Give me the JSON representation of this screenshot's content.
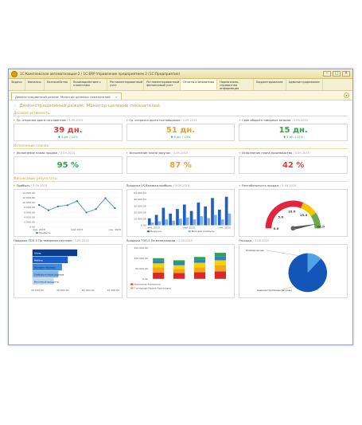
{
  "window": {
    "title": "1С:Комплексная автоматизация 2 / 1С:ERP Управление предприятием 2 (1С:Предприятие)"
  },
  "sections": [
    {
      "label": "Задачи"
    },
    {
      "label": "Финансы"
    },
    {
      "label": "Казначейство"
    },
    {
      "label": "Взаимодействие с клиентами"
    },
    {
      "label": "Регламентированный учет"
    },
    {
      "label": "Регламентированный финансовый учет"
    },
    {
      "label": "Отчеты и аналитика"
    },
    {
      "label": "Нормативно-справочная информация"
    },
    {
      "label": "Бюджетирование"
    },
    {
      "label": "Администрирование"
    }
  ],
  "tab": {
    "label": "Демонстрационный режим: Монитор целевых показателей",
    "close": "×"
  },
  "page": {
    "title": "Демонстрационный режим: Монитор целевых показателей"
  },
  "sec1": {
    "title": "Деловая активность",
    "kpis": [
      {
        "label": "Ср. отсрочка долга по клиентам",
        "date": "/ 3.09.2015",
        "value": "39 дн.",
        "sub": "▼ 4 дн. / 10%",
        "color": "#e03a3a"
      },
      {
        "label": "Ср. отсрочка долга поставщикам",
        "date": "/ 3.09.2015",
        "value": "51 дн.",
        "sub": "▼ 6 дн. / 13%",
        "color": "#f0a020"
      },
      {
        "label": "Срок оборота товарных запасов",
        "date": "/ 3.09.2015",
        "value": "15 дн.",
        "sub": "▼ 3 дн. / 21%",
        "color": "#2fa34a"
      }
    ]
  },
  "sec2": {
    "title": "Исполнение планов",
    "kpis": [
      {
        "label": "Исполнение плана продаж",
        "date": "/ 3.09.2015",
        "value": "95 %",
        "color": "#2fa34a"
      },
      {
        "label": "Исполнение плана закупок",
        "date": "/ 3.09.2015",
        "value": "87 %",
        "color": "#f0a020"
      },
      {
        "label": "Исполнение плана производства",
        "date": "/ 3.09.2015",
        "value": "42 %",
        "color": "#e03a3a"
      }
    ]
  },
  "sec3": {
    "title": "Финансовые результаты"
  },
  "charts": {
    "profit": {
      "label": "Прибыль",
      "date": "/ 3.09.2015",
      "legend": "Прибыль"
    },
    "sales": {
      "label": "Продажи VS Валовая прибыль",
      "date": "/ 3.09.2015",
      "legend1": "Выручка",
      "legend2": "Валовая прибыль"
    },
    "profitability": {
      "label": "Рентабельность продаж",
      "date": "/ 3.09.2015"
    },
    "salesGroups": {
      "label": "Продажи ТОП-5 По товарным группам",
      "date": "/ 3.09.2015"
    },
    "salesManagers": {
      "label": "Продажи ТОП-5 По менеджерам",
      "date": "/ 3.09.2015",
      "legend1": "Максимов Филиппов",
      "legend2": "Гончарова Ирина Архиповна"
    },
    "expenses": {
      "label": "Расходы",
      "date": "/ 3.09.2015",
      "slice1": "Коммерческие",
      "slice2": "Административные расходы"
    }
  },
  "chart_data": [
    {
      "type": "line",
      "title": "Прибыль",
      "x": [
        "янв. 2015",
        "фев. 2015",
        "мар. 2015",
        "апр. 2015",
        "май 2015",
        "июн. 2015",
        "июл. 2015",
        "авг. 2015",
        "сен. 2015"
      ],
      "xticks": [
        "янв. 2015",
        "май 2015",
        "сен. 2015"
      ],
      "series": [
        {
          "name": "Прибыль",
          "values": [
            9000,
            6800,
            8400,
            8900,
            10600,
            5900,
            7300,
            11800,
            7700
          ]
        }
      ],
      "yticks": [
        "14 000.00",
        "12 000.00",
        "10 000.00",
        "8 000.00",
        "6 000.00",
        "4 000.00",
        "2 000.00",
        "0.00"
      ],
      "ylim": [
        0,
        14000
      ]
    },
    {
      "type": "bar",
      "title": "Продажи VS Валовая прибыль",
      "xticks": [
        "янв. 2015",
        "май 2015",
        "сен. 2015"
      ],
      "series": [
        {
          "name": "Выручка",
          "values": [
            10500,
            16000,
            27000,
            18000,
            25000,
            32000,
            22000,
            35000,
            29000,
            42000,
            24000,
            44000
          ]
        },
        {
          "name": "Валовая прибыль",
          "values": [
            4000,
            6000,
            9000,
            7000,
            10000,
            12000,
            9000,
            14000,
            11000,
            16000,
            9000,
            18000
          ]
        }
      ],
      "yticks": [
        "50 000.00",
        "40 000.00",
        "30 000.00",
        "20 000.00",
        "10 000.00",
        "0.00"
      ],
      "ylim": [
        0,
        50000
      ]
    },
    {
      "type": "gauge",
      "title": "Рентабельность продаж",
      "value": 21.2,
      "ticks": [
        "0.0",
        "5.0",
        "10.0",
        "15.0"
      ],
      "max_label": "20,0",
      "ranges": [
        {
          "from": 0,
          "to": 13,
          "color": "#e0253c"
        },
        {
          "from": 13,
          "to": 17,
          "color": "#f5c400"
        },
        {
          "from": 17,
          "to": 21,
          "color": "#6aa84f"
        }
      ]
    },
    {
      "type": "bar",
      "title": "Продажи ТОП-5 По товарным группам",
      "orientation": "horizontal",
      "categories": [
        "Обувь",
        "Мебель",
        "Бытовая техника",
        "Хлебобулочные изделия",
        "Молочные продукты"
      ],
      "values": [
        38000,
        30000,
        25000,
        22000,
        18000
      ],
      "xticks": [
        "20 000.00",
        "40 000.00",
        "60 000.00",
        "10 000.00"
      ]
    },
    {
      "type": "bar",
      "title": "Продажи ТОП-5 По менеджерам",
      "stacked": true,
      "yticks": [
        "150 000.00",
        "100 000.00",
        "50 000.00",
        "0.00"
      ],
      "series": [
        {
          "name": "Максимов Филиппов",
          "values": [
            30000,
            28000,
            32000,
            36000
          ]
        },
        {
          "name": "Гончарова Ирина Архиповна",
          "values": [
            25000,
            20000,
            24000,
            30000
          ]
        },
        {
          "name": "",
          "values": [
            20000,
            18000,
            22000,
            24000
          ]
        },
        {
          "name": "",
          "values": [
            15000,
            14000,
            16000,
            20000
          ]
        },
        {
          "name": "",
          "values": [
            10000,
            10000,
            12000,
            16000
          ]
        }
      ]
    },
    {
      "type": "pie",
      "title": "Расходы",
      "slices": [
        {
          "name": "Коммерческие",
          "value": 12
        },
        {
          "name": "Административные расходы",
          "value": 88
        }
      ]
    }
  ]
}
